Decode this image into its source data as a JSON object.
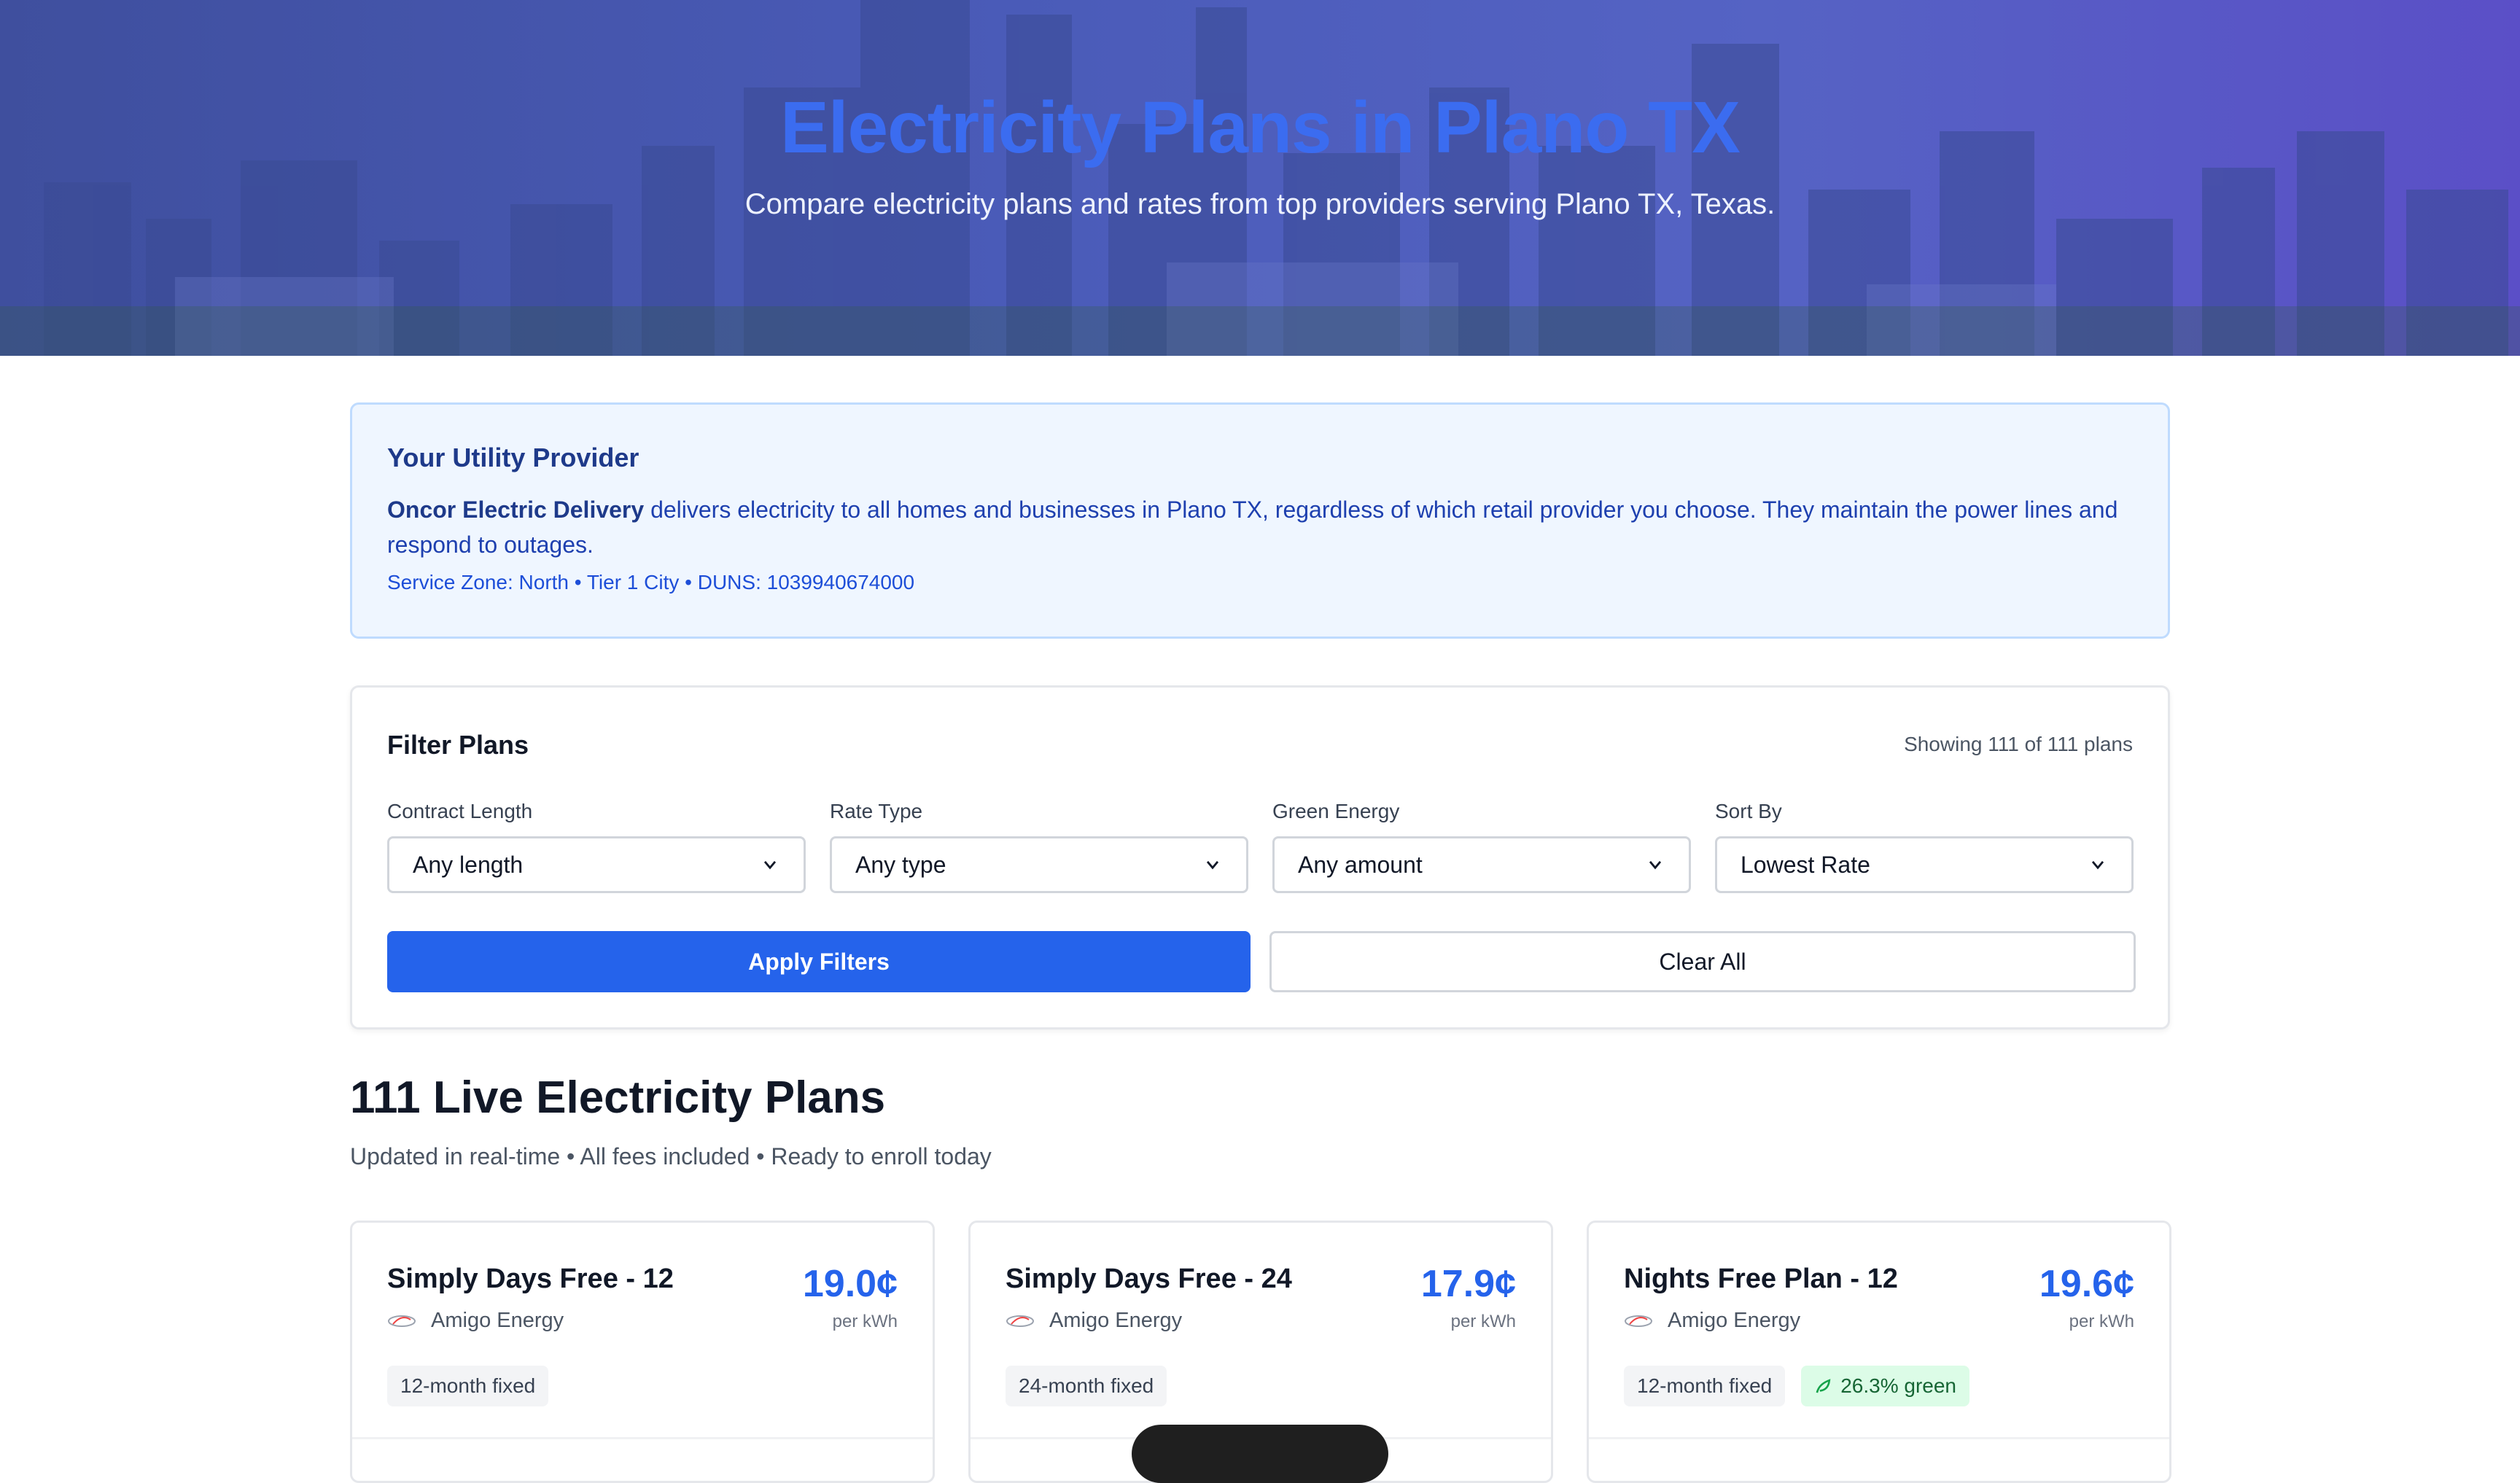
{
  "hero": {
    "title": "Electricity Plans in Plano TX",
    "subtitle": "Compare electricity plans and rates from top providers serving Plano TX, Texas."
  },
  "utility": {
    "title": "Your Utility Provider",
    "provider_name": "Oncor Electric Delivery",
    "description": " delivers electricity to all homes and businesses in Plano TX, regardless of which retail provider you choose. They maintain the power lines and respond to outages.",
    "meta": "Service Zone: North • Tier 1 City • DUNS: 1039940674000"
  },
  "filters": {
    "title": "Filter Plans",
    "count": "Showing 111 of 111 plans",
    "fields": [
      {
        "label": "Contract Length",
        "value": "Any length"
      },
      {
        "label": "Rate Type",
        "value": "Any type"
      },
      {
        "label": "Green Energy",
        "value": "Any amount"
      },
      {
        "label": "Sort By",
        "value": "Lowest Rate"
      }
    ],
    "apply_label": "Apply Filters",
    "clear_label": "Clear All"
  },
  "plans_section": {
    "heading": "111 Live Electricity Plans",
    "subheading": "Updated in real-time • All fees included • Ready to enroll today"
  },
  "plans": [
    {
      "name": "Simply Days Free - 12",
      "rate": "19.0¢",
      "unit": "per kWh",
      "provider": "Amigo Energy",
      "tags": [
        "12-month fixed"
      ],
      "green": ""
    },
    {
      "name": "Simply Days Free - 24",
      "rate": "17.9¢",
      "unit": "per kWh",
      "provider": "Amigo Energy",
      "tags": [
        "24-month fixed"
      ],
      "green": ""
    },
    {
      "name": "Nights Free Plan - 12",
      "rate": "19.6¢",
      "unit": "per kWh",
      "provider": "Amigo Energy",
      "tags": [
        "12-month fixed"
      ],
      "green": "26.3% green"
    }
  ],
  "icons": {
    "select_caret": "chevron-down-icon",
    "provider_logo": "amigo-energy-logo",
    "green_tag": "leaf-icon"
  },
  "colors": {
    "accent": "#2563eb",
    "hero_title": "#3b6cf0",
    "utility_bg": "#eff6ff",
    "green_tag_bg": "#dcfce7"
  }
}
